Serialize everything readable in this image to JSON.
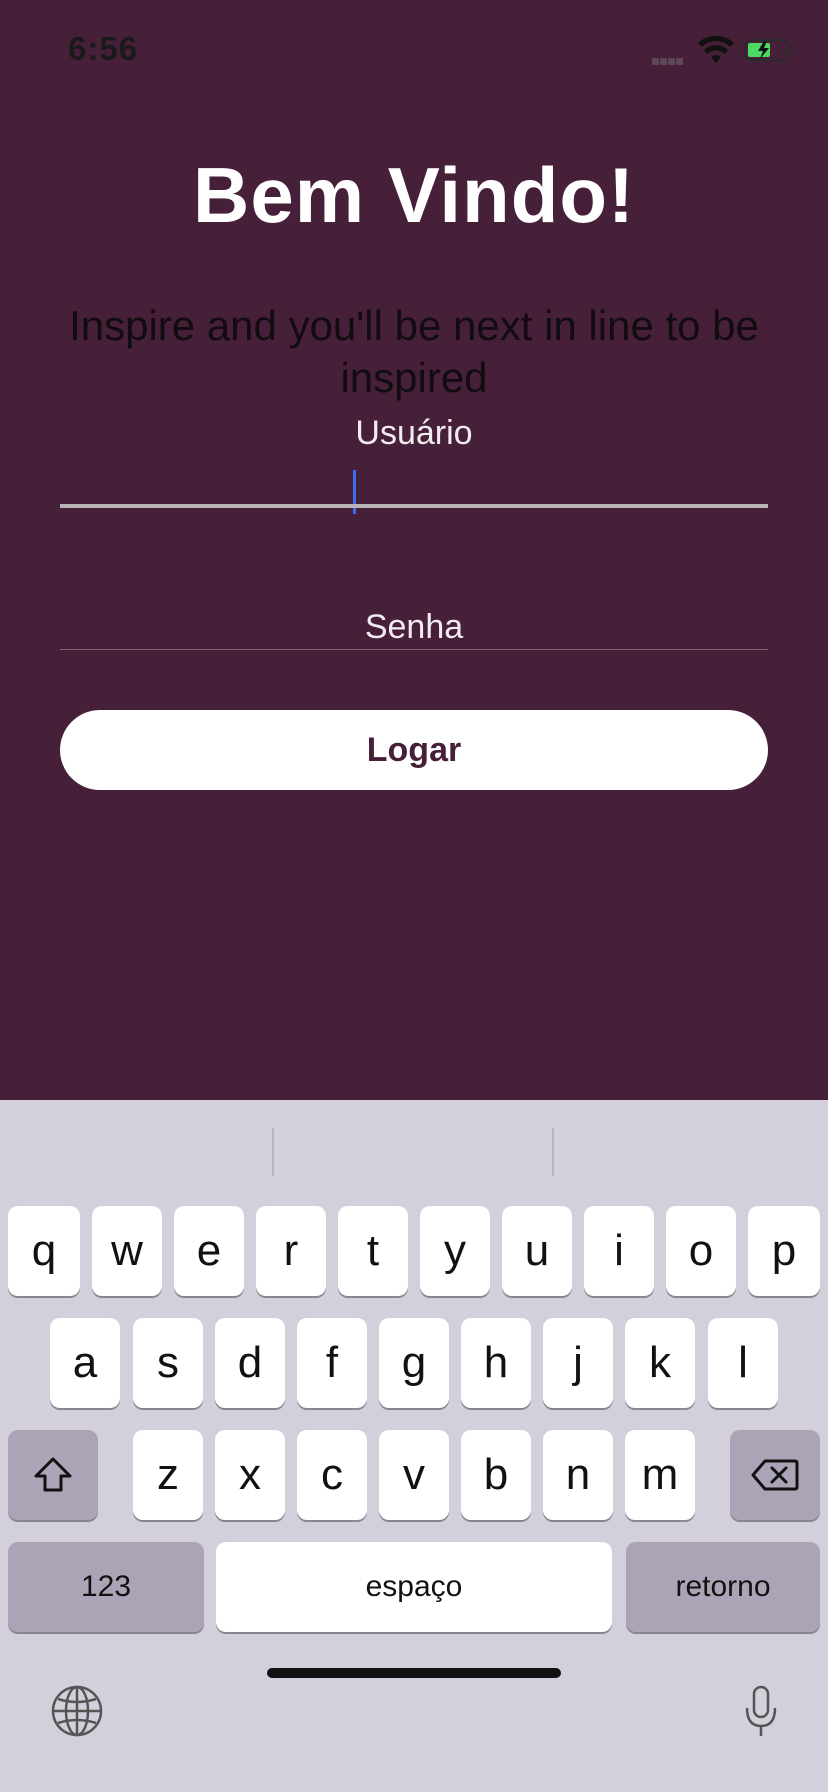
{
  "status": {
    "time": "6:56"
  },
  "header": {
    "title": "Bem Vindo!",
    "subtitle": "Inspire and you'll be next in line to be inspired"
  },
  "form": {
    "user_label": "Usuário",
    "password_label": "Senha",
    "login_label": "Logar"
  },
  "keyboard": {
    "row1": [
      "q",
      "w",
      "e",
      "r",
      "t",
      "y",
      "u",
      "i",
      "o",
      "p"
    ],
    "row2": [
      "a",
      "s",
      "d",
      "f",
      "g",
      "h",
      "j",
      "k",
      "l"
    ],
    "row3": [
      "z",
      "x",
      "c",
      "v",
      "b",
      "n",
      "m"
    ],
    "numbers_label": "123",
    "space_label": "espaço",
    "return_label": "retorno"
  },
  "colors": {
    "background": "#461f38",
    "button": "#ffffff",
    "caret": "#3a6df0",
    "keyboard": "#d3cfdb"
  },
  "icons": [
    "wifi-icon",
    "battery-icon",
    "signal-icon",
    "shift-icon",
    "backspace-icon",
    "globe-icon",
    "microphone-icon"
  ]
}
